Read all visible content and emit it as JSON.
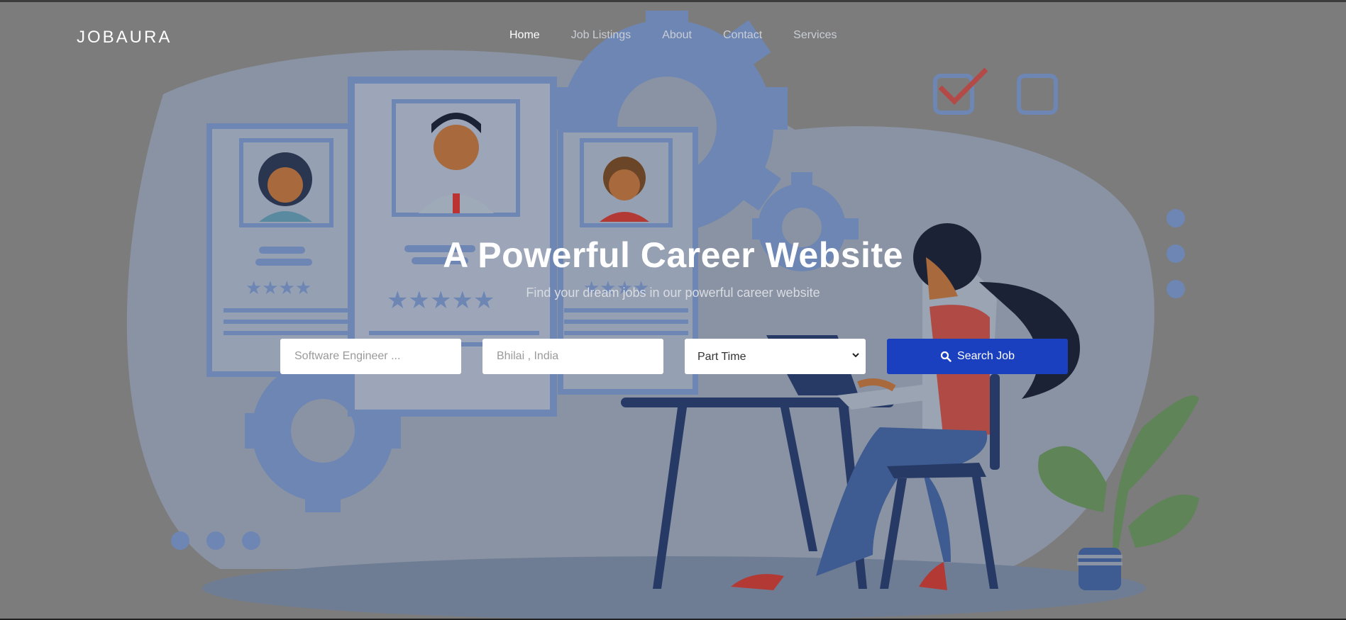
{
  "brand": {
    "logo": "JOBAURA"
  },
  "nav": {
    "items": [
      {
        "label": "Home",
        "active": true
      },
      {
        "label": "Job Listings",
        "active": false
      },
      {
        "label": "About",
        "active": false
      },
      {
        "label": "Contact",
        "active": false
      },
      {
        "label": "Services",
        "active": false
      }
    ]
  },
  "hero": {
    "title": "A Powerful Career Website",
    "subtitle": "Find your dream jobs in our powerful career website"
  },
  "search": {
    "keyword_placeholder": "Software Engineer ...",
    "location_placeholder": "Bhilai , India",
    "job_type_selected": "Part Time",
    "button_label": "Search Job",
    "button_icon": "search-icon"
  },
  "colors": {
    "accent": "#1a3fbf",
    "illustration_blue": "#6f8bb8",
    "overlay_gray": "#7c7c7c"
  }
}
